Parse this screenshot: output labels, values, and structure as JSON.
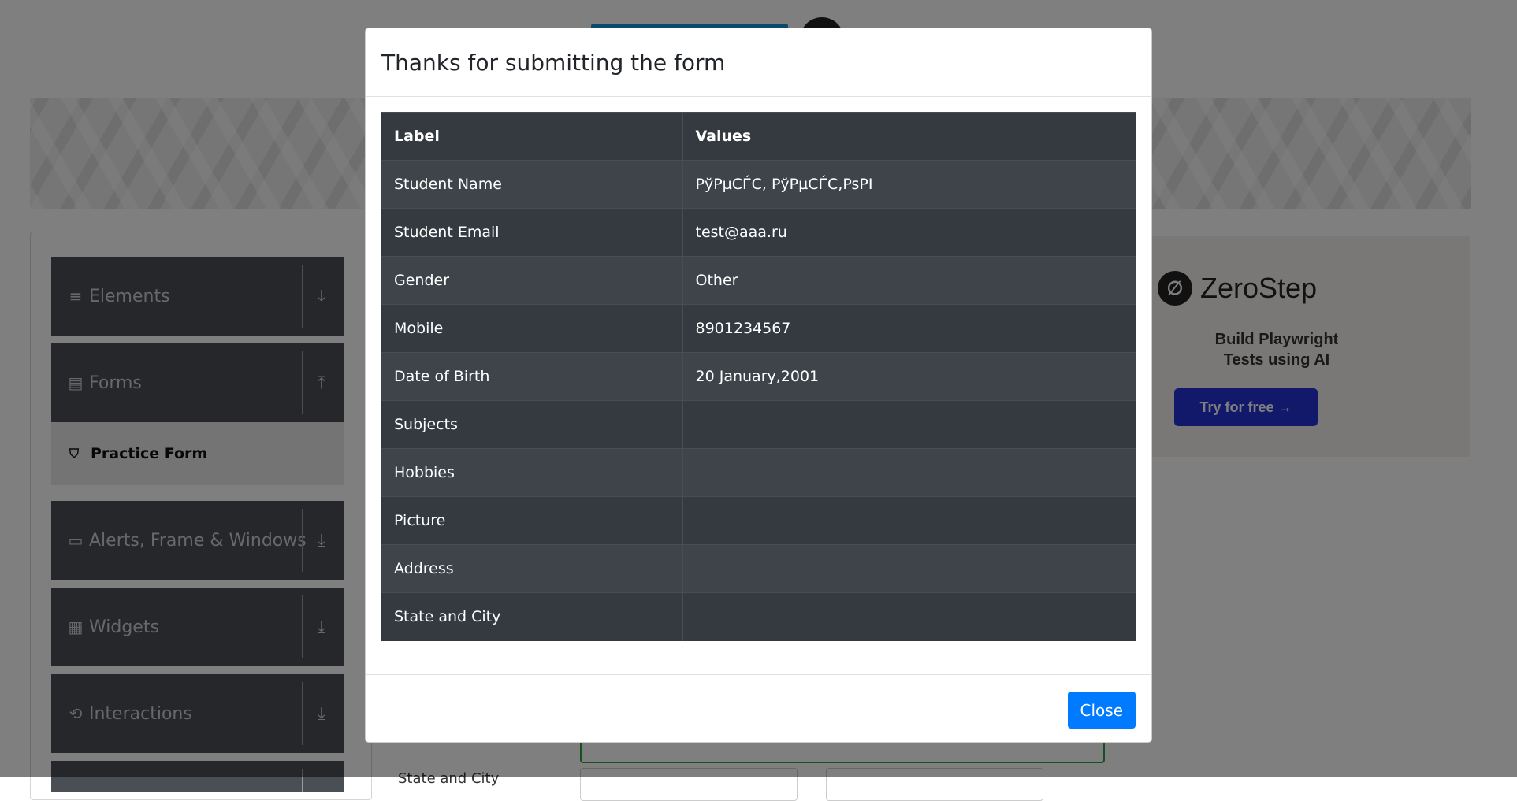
{
  "sidebar": {
    "groups": [
      {
        "label": "Elements",
        "icon": "list-icon",
        "arrow": "download-arrow-icon"
      },
      {
        "label": "Forms",
        "icon": "document-icon",
        "arrow": "upload-arrow-icon"
      },
      {
        "label": "Alerts, Frame & Windows",
        "icon": "window-icon",
        "arrow": "download-arrow-icon"
      },
      {
        "label": "Widgets",
        "icon": "widgets-icon",
        "arrow": "download-arrow-icon"
      },
      {
        "label": "Interactions",
        "icon": "interactions-icon",
        "arrow": "download-arrow-icon"
      }
    ],
    "active_item": {
      "label": "Practice Form",
      "icon": "html5-icon"
    }
  },
  "ad": {
    "brand": "ZeroStep",
    "headline_line1": "Build Playwright",
    "headline_line2": "Tests using AI",
    "cta": "Try for free →"
  },
  "background_form": {
    "state_label": "State and City"
  },
  "modal": {
    "title": "Thanks for submitting the form",
    "table": {
      "headers": [
        "Label",
        "Values"
      ],
      "rows": [
        {
          "label": "Student Name",
          "value": "PўPµCЃC, PўPµCЃC,PsPI"
        },
        {
          "label": "Student Email",
          "value": "test@aaa.ru"
        },
        {
          "label": "Gender",
          "value": "Other"
        },
        {
          "label": "Mobile",
          "value": "8901234567"
        },
        {
          "label": "Date of Birth",
          "value": "20 January,2001"
        },
        {
          "label": "Subjects",
          "value": ""
        },
        {
          "label": "Hobbies",
          "value": ""
        },
        {
          "label": "Picture",
          "value": ""
        },
        {
          "label": "Address",
          "value": ""
        },
        {
          "label": "State and City",
          "value": ""
        }
      ]
    },
    "close_label": "Close"
  },
  "colors": {
    "primary_button": "#007bff",
    "table_dark": "#343a40",
    "table_stripe": "#3e444a",
    "sidebar_group": "#4a4e55",
    "ad_button": "#2533d4",
    "backdrop": "rgba(0,0,0,0.5)"
  }
}
